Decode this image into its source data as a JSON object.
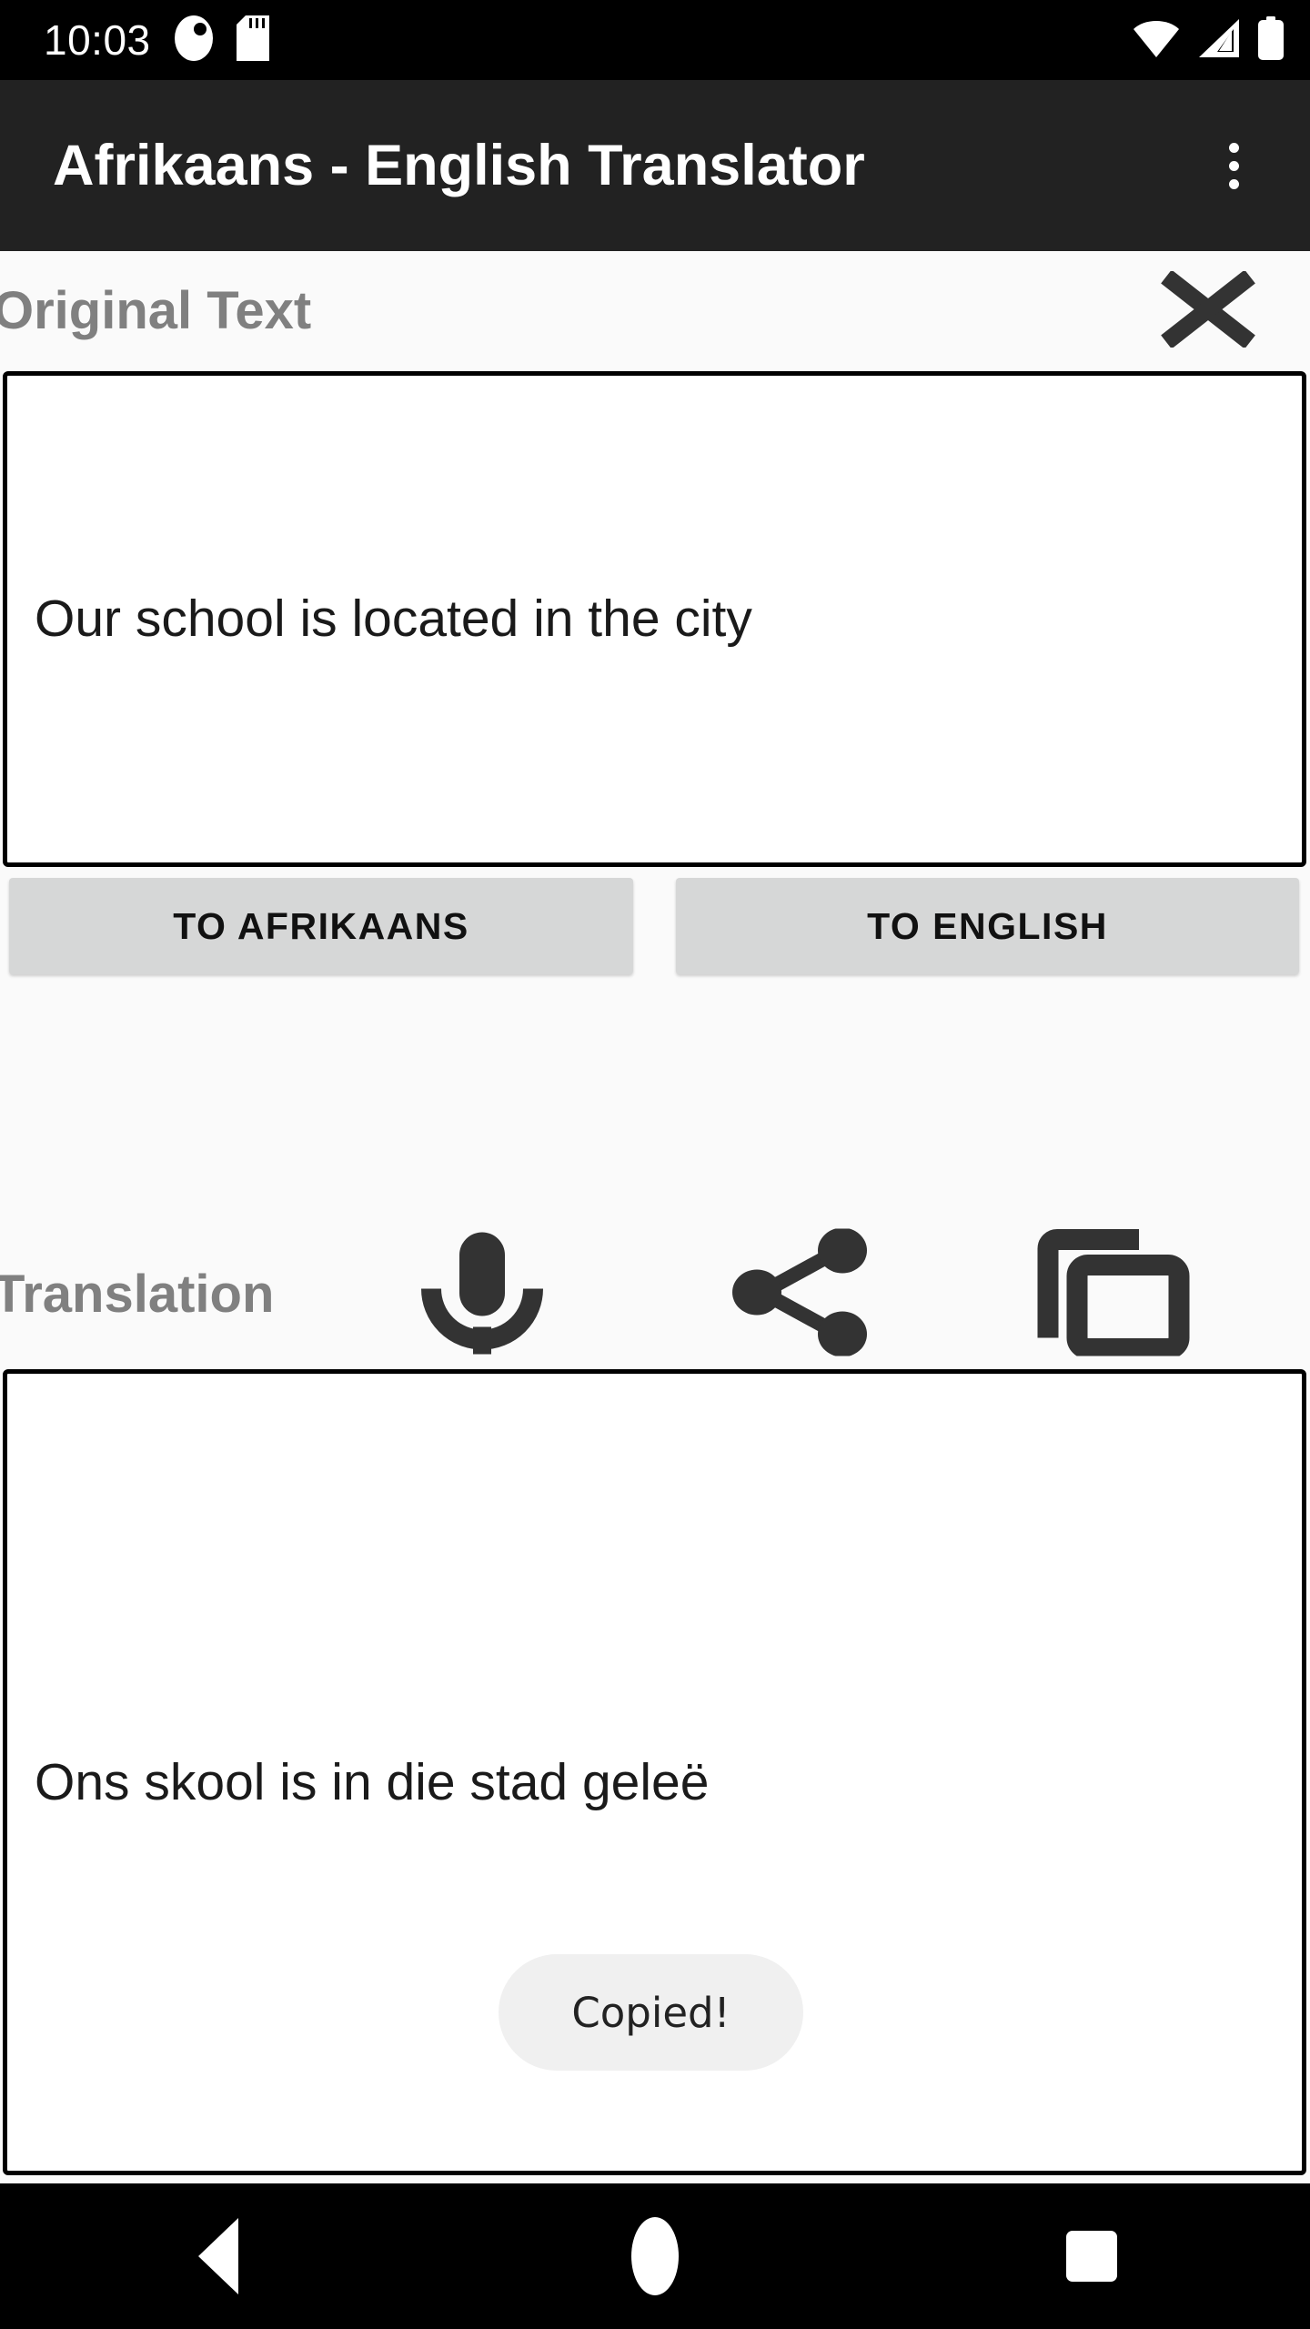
{
  "status_bar": {
    "time": "10:03",
    "left_icons": [
      {
        "name": "app-notification-icon"
      },
      {
        "name": "sd-card-icon"
      }
    ],
    "right_icons": [
      {
        "name": "wifi-icon",
        "level": "full"
      },
      {
        "name": "cellular-signal-icon",
        "level": "partial"
      },
      {
        "name": "battery-icon",
        "level": "full"
      }
    ],
    "background_color": "#000000"
  },
  "app_bar": {
    "title": "Afrikaans - English Translator",
    "background_color": "#222222",
    "text_color": "#ffffff",
    "overflow_menu_icon": "more-vert-icon"
  },
  "original_section": {
    "label": "Original Text",
    "clear_icon": "close-x-icon",
    "input": {
      "value": "Our school is located in the city",
      "placeholder": "",
      "border_color": "#000000",
      "background_color": "#ffffff"
    }
  },
  "actions": {
    "to_afrikaans_label": "TO AFRIKAANS",
    "to_english_label": "TO ENGLISH",
    "button_color": "#d6d7d7",
    "button_text_color": "#111111"
  },
  "translation_section": {
    "label": "Translation",
    "icons": [
      {
        "name": "microphone-icon",
        "tooltip": "Speak"
      },
      {
        "name": "share-icon",
        "tooltip": "Share"
      },
      {
        "name": "copy-icon",
        "tooltip": "Copy"
      }
    ],
    "output": {
      "value": "Ons skool is in die stad geleë",
      "border_color": "#000000",
      "background_color": "#ffffff"
    }
  },
  "toast": {
    "message": "Copied!",
    "background_color": "#f0f0f0",
    "text_color": "#222222"
  },
  "nav_bar": {
    "background_color": "#000000",
    "buttons": [
      {
        "name": "back-button",
        "icon": "triangle-left-icon"
      },
      {
        "name": "home-button",
        "icon": "circle-icon"
      },
      {
        "name": "recents-button",
        "icon": "square-icon"
      }
    ]
  },
  "theme": {
    "page_background": "#fafafa",
    "label_color": "#808080",
    "icon_color": "#333333"
  }
}
